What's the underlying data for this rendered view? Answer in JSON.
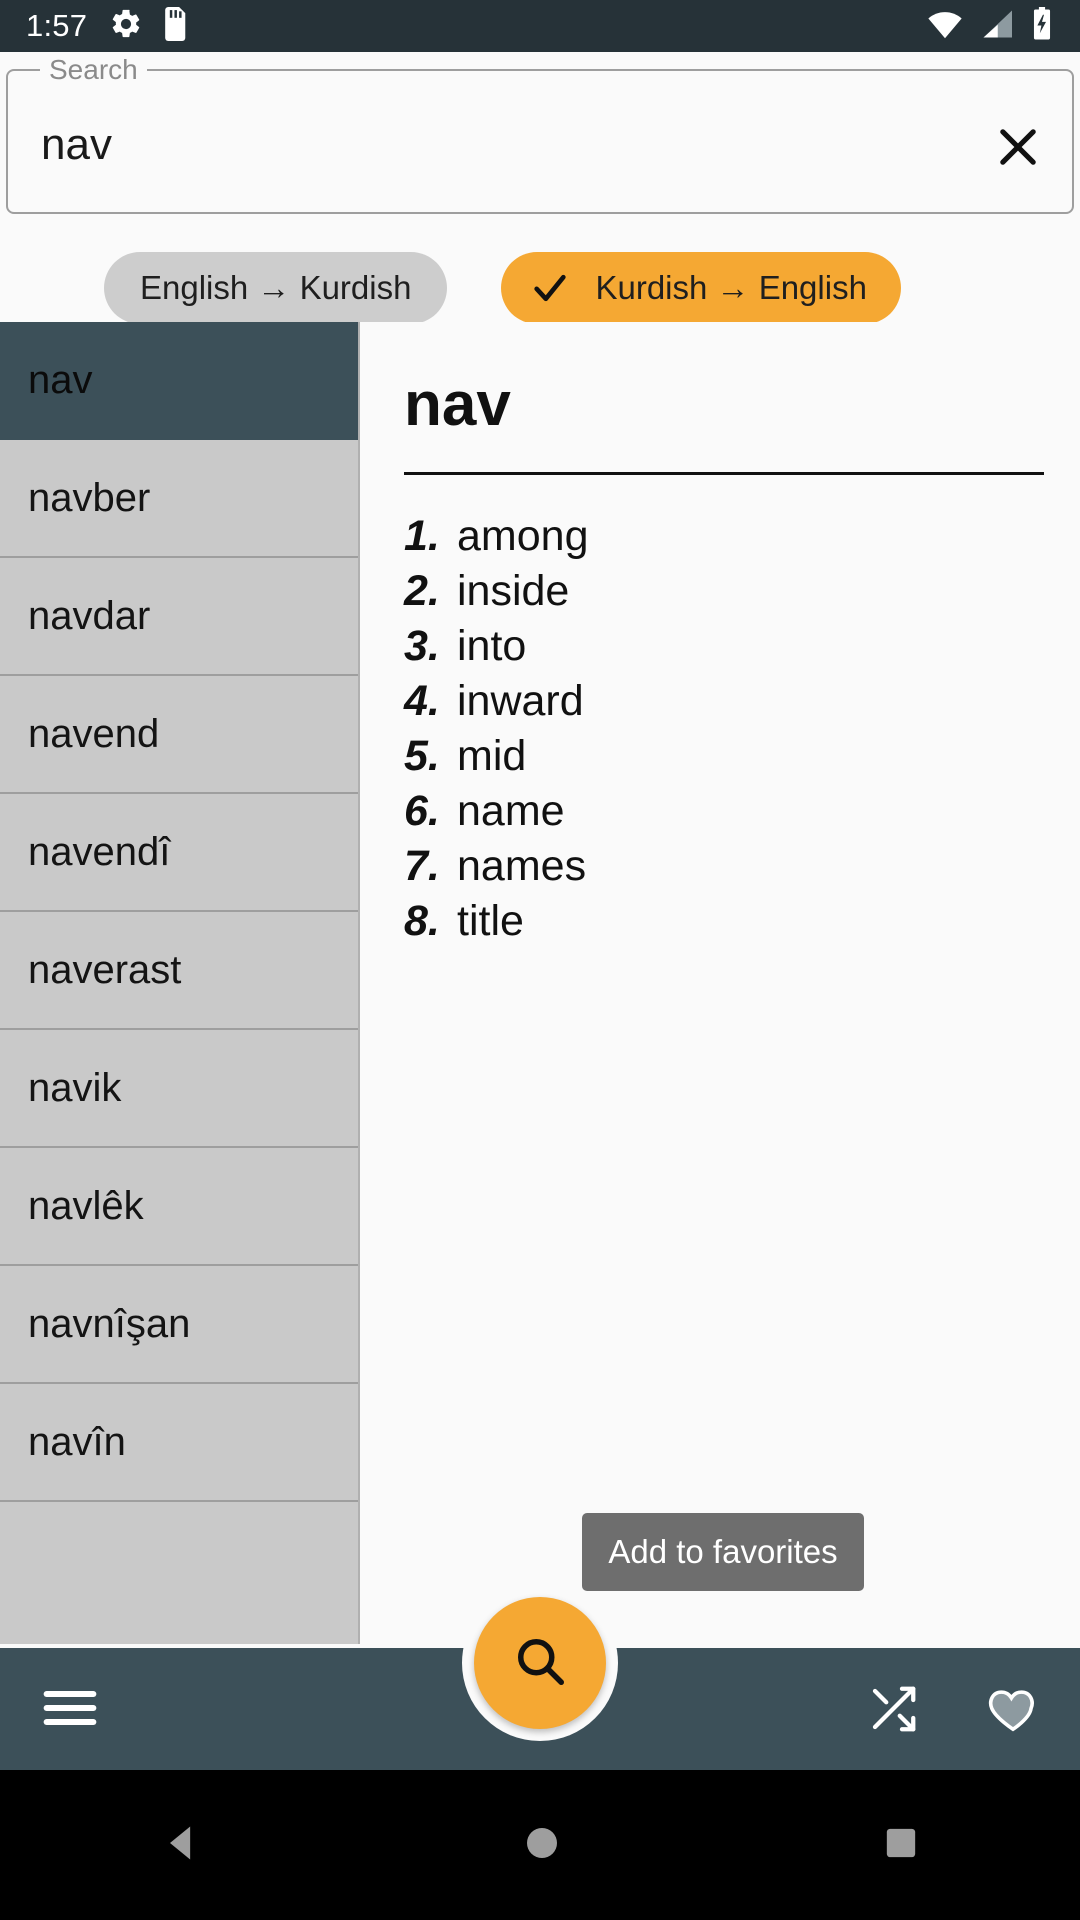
{
  "statusbar": {
    "time": "1:57",
    "left_icons": [
      "gear-icon",
      "sd-card-icon"
    ],
    "right_icons": [
      "wifi-icon",
      "signal-icon",
      "battery-charging-icon"
    ]
  },
  "search": {
    "label": "Search",
    "value": "nav",
    "placeholder": "Search",
    "clear_icon": "close-icon"
  },
  "direction_toggle": {
    "options": [
      {
        "label": "English → Kurdish",
        "selected": false
      },
      {
        "label": "Kurdish → English",
        "selected": true
      }
    ],
    "selected_color": "#f5a833",
    "unselected_color": "#cdcdcd"
  },
  "wordlist": {
    "selected": "nav",
    "items": [
      {
        "label": "nav",
        "selected": true
      },
      {
        "label": "navber",
        "selected": false
      },
      {
        "label": "navdar",
        "selected": false
      },
      {
        "label": "navend",
        "selected": false
      },
      {
        "label": "navendî",
        "selected": false
      },
      {
        "label": "naverast",
        "selected": false
      },
      {
        "label": "navik",
        "selected": false
      },
      {
        "label": "navlêk",
        "selected": false
      },
      {
        "label": "navnîşan",
        "selected": false
      },
      {
        "label": "navîn",
        "selected": false
      }
    ]
  },
  "definition": {
    "headword": "nav",
    "senses": [
      {
        "num": "1.",
        "text": "among"
      },
      {
        "num": "2.",
        "text": "inside"
      },
      {
        "num": "3.",
        "text": "into"
      },
      {
        "num": "4.",
        "text": "inward"
      },
      {
        "num": "5.",
        "text": "mid"
      },
      {
        "num": "6.",
        "text": "name"
      },
      {
        "num": "7.",
        "text": "names"
      },
      {
        "num": "8.",
        "text": "title"
      }
    ],
    "favorites_button": "Add to favorites"
  },
  "bottombar": {
    "menu_icon": "hamburger-menu-icon",
    "fab_icon": "search-icon",
    "shuffle_icon": "shuffle-icon",
    "favorites_icon": "heart-icon",
    "background_color": "#3c5059",
    "fab_color": "#f5a833"
  },
  "android_nav": {
    "back": "back-triangle-icon",
    "home": "home-circle-icon",
    "recents": "recents-square-icon"
  }
}
